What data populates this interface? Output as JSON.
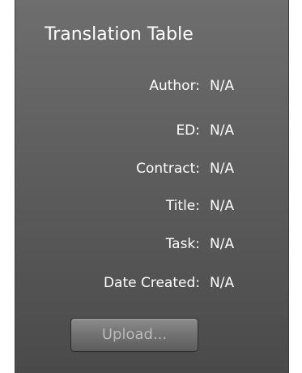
{
  "panel": {
    "title": "Translation Table",
    "fields": [
      {
        "label": "Author:",
        "value": "N/A"
      },
      {
        "label": "ED:",
        "value": "N/A"
      },
      {
        "label": "Contract:",
        "value": "N/A"
      },
      {
        "label": "Title:",
        "value": "N/A"
      },
      {
        "label": "Task:",
        "value": "N/A"
      },
      {
        "label": "Date Created:",
        "value": "N/A"
      }
    ],
    "upload_label": "Upload..."
  },
  "colors": {
    "panel_top": "#6e6e6e",
    "panel_bottom": "#4a4a4a",
    "text": "#ffffff",
    "button_text_disabled": "#b9b9b9"
  }
}
